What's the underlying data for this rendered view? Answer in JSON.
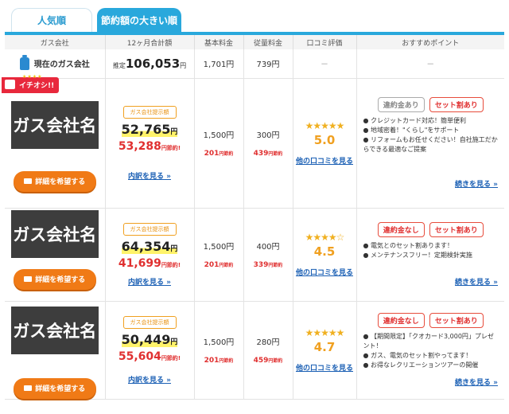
{
  "tabs": [
    {
      "label": "人気順"
    },
    {
      "label": "節約額の大きい順"
    }
  ],
  "headers": [
    "ガス会社",
    "12ヶ月合計額",
    "基本料金",
    "従量料金",
    "口コミ評価",
    "おすすめポイント"
  ],
  "current": {
    "name": "現在のガス会社",
    "estimate_label": "推定",
    "total": "106,053",
    "yen": "円",
    "basic": "1,701円",
    "usage": "739円",
    "review": "－",
    "point": "－"
  },
  "badge": {
    "label": "イチオシ!!",
    "stars": "★★★★"
  },
  "rows": [
    {
      "company": "ガス会社名",
      "request_label": "詳細を希望する",
      "offer_label": "ガス会社提示額",
      "offer_price": "52,765",
      "yen": "円",
      "red_price": "53,288",
      "red_suffix": "円節約!",
      "breakdown_link": "内訳を見る",
      "basic": "1,500円",
      "basic_save": "201",
      "basic_save_suffix": "円節約",
      "usage": "300円",
      "usage_save": "439",
      "usage_save_suffix": "円節約",
      "stars": "★★★★★",
      "score": "5.0",
      "review_link": "他の口コミを見る",
      "tags": [
        {
          "label": "違約金あり",
          "style": "grey"
        },
        {
          "label": "セット割あり",
          "style": "red"
        }
      ],
      "points": [
        "● クレジットカード対応！簡単便利",
        "● 地域密着！\"くらし\"をサポート",
        "● リフォームもお任せください！自社施工だからできる最適なご提案"
      ],
      "more_link": "続きを見る"
    },
    {
      "company": "ガス会社名",
      "request_label": "詳細を希望する",
      "offer_label": "ガス会社提示額",
      "offer_price": "64,354",
      "yen": "円",
      "red_price": "41,699",
      "red_suffix": "円節約!",
      "breakdown_link": "内訳を見る",
      "basic": "1,500円",
      "basic_save": "201",
      "basic_save_suffix": "円節約",
      "usage": "400円",
      "usage_save": "339",
      "usage_save_suffix": "円節約",
      "stars": "★★★★☆",
      "score": "4.5",
      "review_link": "他の口コミを見る",
      "tags": [
        {
          "label": "違約金なし",
          "style": "red"
        },
        {
          "label": "セット割あり",
          "style": "red"
        }
      ],
      "points": [
        "● 電気とのセット割あります！",
        "● メンテナンスフリー！定期検針実施"
      ],
      "more_link": "続きを見る"
    },
    {
      "company": "ガス会社名",
      "request_label": "詳細を希望する",
      "offer_label": "ガス会社提示額",
      "offer_price": "50,449",
      "yen": "円",
      "red_price": "55,604",
      "red_suffix": "円節約!",
      "breakdown_link": "内訳を見る",
      "basic": "1,500円",
      "basic_save": "201",
      "basic_save_suffix": "円節約",
      "usage": "280円",
      "usage_save": "459",
      "usage_save_suffix": "円節約",
      "stars": "★★★★★",
      "score": "4.7",
      "review_link": "他の口コミを見る",
      "tags": [
        {
          "label": "違約金なし",
          "style": "red"
        },
        {
          "label": "セット割あり",
          "style": "red"
        }
      ],
      "points": [
        "● 【期間限定】「クオカード3,000円」プレゼント！",
        "● ガス、電気のセット割やってます！",
        "● お得なレクリエーションツアーの開催"
      ],
      "more_link": "続きを見る"
    }
  ]
}
